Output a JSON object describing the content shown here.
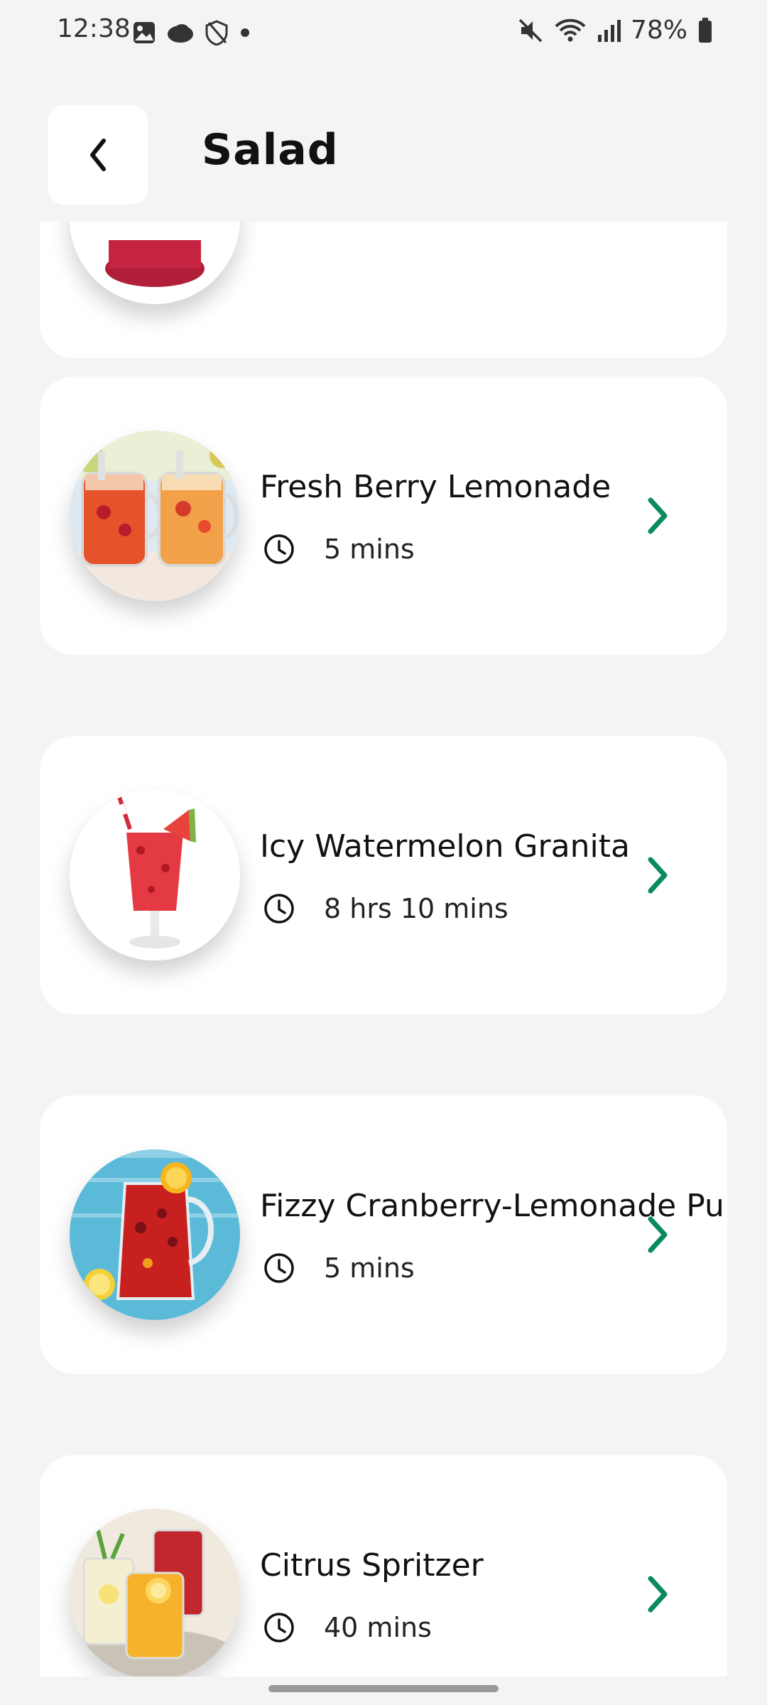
{
  "status_bar": {
    "time": "12:38",
    "left_icons": [
      "gallery-icon",
      "cloud-icon",
      "shield-icon",
      "dot-icon"
    ],
    "right_icons": [
      "mute-icon",
      "wifi-icon",
      "signal-icon",
      "battery-icon"
    ],
    "battery": "78%"
  },
  "header": {
    "back_icon": "chevron-left-icon",
    "title": "Salad"
  },
  "recipes": [
    {
      "title": "",
      "duration": ""
    },
    {
      "title": "Fresh Berry Lemonade",
      "duration": "5 mins"
    },
    {
      "title": "Icy Watermelon Granita",
      "duration": "8 hrs 10 mins"
    },
    {
      "title": "Fizzy Cranberry-Lemonade Pu",
      "duration": "5 mins"
    },
    {
      "title": "Citrus Spritzer",
      "duration": "40 mins"
    }
  ],
  "colors": {
    "accent": "#0a8a5f",
    "background": "#f4f4f4",
    "card": "#ffffff"
  }
}
